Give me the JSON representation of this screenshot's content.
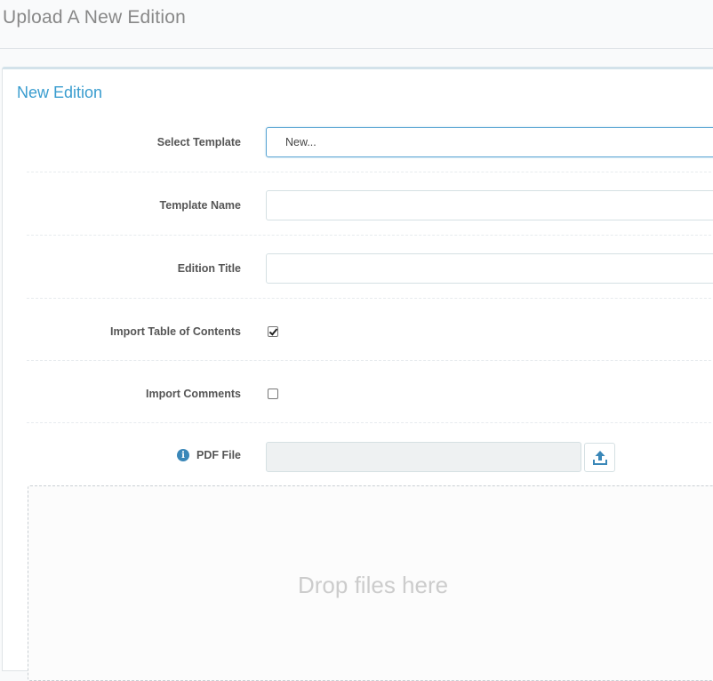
{
  "header": {
    "title": "Upload A New Edition"
  },
  "panel": {
    "title": "New Edition"
  },
  "form": {
    "select_template": {
      "label": "Select Template",
      "value": "New...",
      "caret": "▼"
    },
    "template_name": {
      "label": "Template Name",
      "value": ""
    },
    "edition_title": {
      "label": "Edition Title",
      "value": ""
    },
    "import_toc": {
      "label": "Import Table of Contents",
      "checked": true
    },
    "import_comments": {
      "label": "Import Comments",
      "checked": false
    },
    "pdf_file": {
      "label": "PDF File",
      "info_icon": "info-icon",
      "upload_icon": "upload-icon"
    }
  },
  "dropzone": {
    "text": "Drop files here"
  },
  "colors": {
    "accent": "#3a9dcf",
    "upload_icon": "#3a87b8",
    "info_icon": "#3a87b8"
  }
}
